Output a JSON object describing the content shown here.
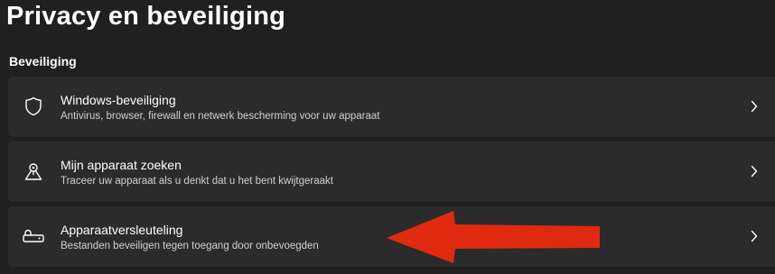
{
  "page": {
    "title": "Privacy en beveiliging"
  },
  "section": {
    "title": "Beveiliging"
  },
  "items": [
    {
      "icon": "shield-icon",
      "title": "Windows-beveiliging",
      "subtitle": "Antivirus, browser, firewall en netwerk bescherming voor uw apparaat"
    },
    {
      "icon": "find-device-icon",
      "title": "Mijn apparaat zoeken",
      "subtitle": "Traceer uw apparaat als u denkt dat u het bent kwijtgeraakt"
    },
    {
      "icon": "device-encryption-icon",
      "title": "Apparaatversleuteling",
      "subtitle": "Bestanden beveiligen tegen toegang door onbevoegden"
    }
  ],
  "colors": {
    "background": "#202020",
    "card": "#2b2b2b",
    "annotation_arrow": "#e02a10"
  }
}
